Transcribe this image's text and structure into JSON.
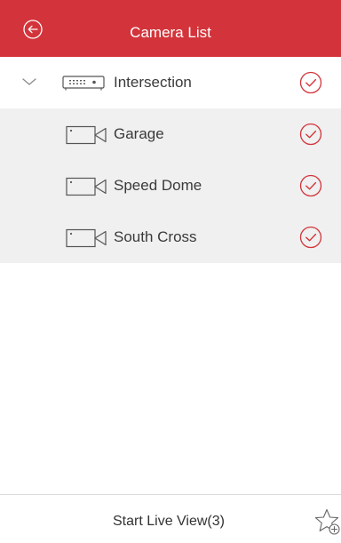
{
  "header": {
    "title": "Camera List",
    "back_icon": "back-arrow-circle-icon"
  },
  "colors": {
    "header_bg": "#d3343b",
    "accent": "#d3343b",
    "camera_row_bg": "#f0f0f0",
    "text": "#3a3a3a"
  },
  "device": {
    "label": "Intersection",
    "expanded": true,
    "selected": true,
    "icon": "nvr-device-icon"
  },
  "cameras": [
    {
      "label": "Garage",
      "selected": true,
      "icon": "camera-icon"
    },
    {
      "label": "Speed Dome",
      "selected": true,
      "icon": "camera-icon"
    },
    {
      "label": "South Cross",
      "selected": true,
      "icon": "camera-icon"
    }
  ],
  "footer": {
    "start_live_label": "Start Live View(3)",
    "favorite_icon": "star-add-icon"
  }
}
